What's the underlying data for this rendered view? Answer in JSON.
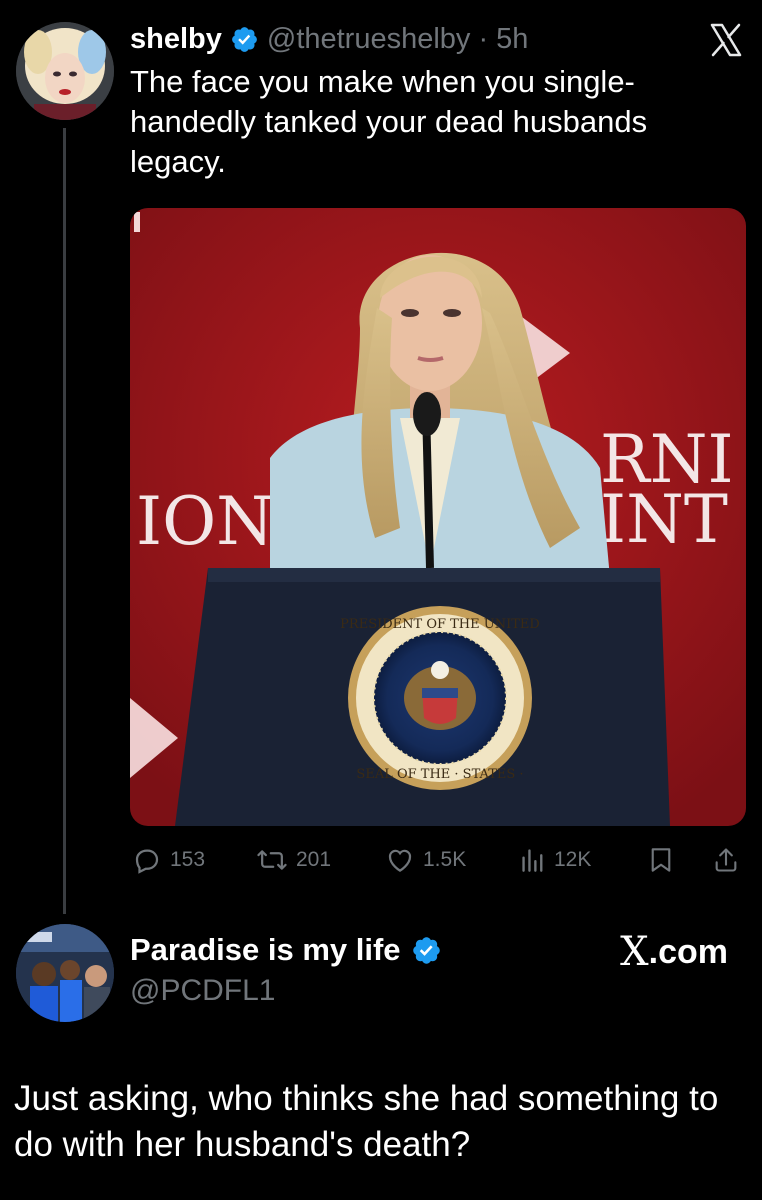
{
  "tweet": {
    "author_name": "shelby",
    "author_handle": "@thetrueshelby",
    "separator": "·",
    "time": "5h",
    "text": "The face you make when you single-handedly tanked your dead husbands legacy.",
    "media": {
      "backdrop_text_left": "ION",
      "backdrop_text_right_1": "RNI",
      "backdrop_text_right_2": "INT",
      "seal_text_top": "PRESIDENT OF THE UNITED",
      "seal_text_bottom": "SEAL OF THE · STATES ·"
    },
    "actions": {
      "replies": "153",
      "reposts": "201",
      "likes": "1.5K",
      "views": "12K"
    }
  },
  "post2": {
    "author_name": "Paradise is my life",
    "author_handle": "@PCDFL1",
    "brand_logo": "X",
    "brand_suffix": ".com",
    "text": "Just asking, who thinks she had something to do with her husband's death?"
  },
  "colors": {
    "background": "#000000",
    "text": "#ffffff",
    "muted": "#71767b",
    "verified": "#1d9bf0",
    "backdrop_red": "#a8181c"
  },
  "icons": [
    "verified-badge-icon",
    "x-logo-icon",
    "reply-icon",
    "repost-icon",
    "like-icon",
    "views-icon",
    "bookmark-icon",
    "share-icon"
  ]
}
